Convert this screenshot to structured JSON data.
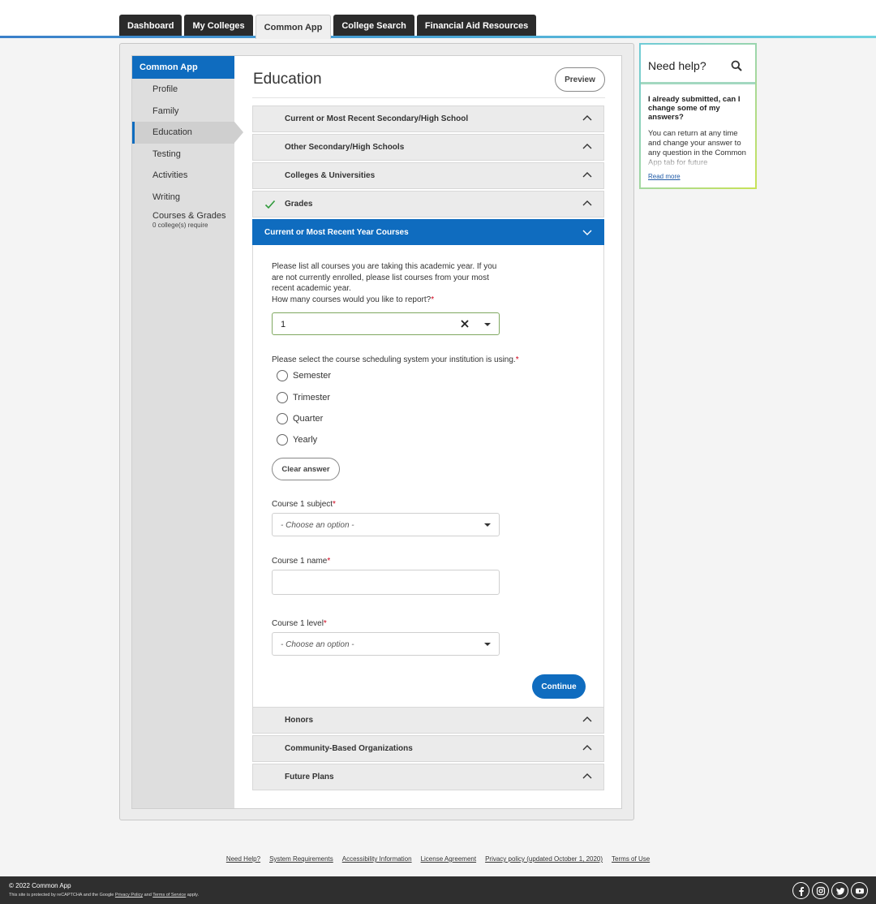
{
  "nav": {
    "tabs": [
      {
        "label": "Dashboard",
        "active": false
      },
      {
        "label": "My Colleges",
        "active": false
      },
      {
        "label": "Common App",
        "active": true
      },
      {
        "label": "College Search",
        "active": false
      },
      {
        "label": "Financial Aid Resources",
        "active": false
      }
    ],
    "accent_color": "#0f6cbf"
  },
  "sidebar": {
    "header": "Common App",
    "items": [
      {
        "label": "Profile"
      },
      {
        "label": "Family"
      },
      {
        "label": "Education",
        "active": true
      },
      {
        "label": "Testing"
      },
      {
        "label": "Activities"
      },
      {
        "label": "Writing"
      },
      {
        "label": "Courses & Grades",
        "sublabel": "0 college(s) require"
      }
    ]
  },
  "main": {
    "title": "Education",
    "preview_label": "Preview",
    "sections": [
      {
        "label": "Current or Most Recent Secondary/High School",
        "state": "collapsed"
      },
      {
        "label": "Other Secondary/High Schools",
        "state": "collapsed"
      },
      {
        "label": "Colleges & Universities",
        "state": "collapsed"
      },
      {
        "label": "Grades",
        "state": "collapsed",
        "completed": true
      },
      {
        "label": "Current or Most Recent Year Courses",
        "state": "expanded"
      },
      {
        "label": "Honors",
        "state": "collapsed"
      },
      {
        "label": "Community-Based Organizations",
        "state": "collapsed"
      },
      {
        "label": "Future Plans",
        "state": "collapsed"
      }
    ],
    "form": {
      "intro": "Please list all courses you are taking this academic year. If you are not currently enrolled, please list courses from your most recent academic year.",
      "count_label": "How many courses would you like to report?",
      "count_value": "1",
      "schedule_label": "Please select the course scheduling system your institution is using.",
      "schedule_options": [
        "Semester",
        "Trimester",
        "Quarter",
        "Yearly"
      ],
      "schedule_selected": null,
      "clear_label": "Clear answer",
      "subject_label": "Course 1 subject",
      "subject_placeholder": "- Choose an option -",
      "name_label": "Course 1 name",
      "name_value": "",
      "level_label": "Course 1 level",
      "level_placeholder": "- Choose an option -",
      "required_mark": "*",
      "continue_label": "Continue"
    }
  },
  "help": {
    "title": "Need help?",
    "question": "I already submitted, can I change some of my answers?",
    "answer": "You can return at any time and change your answer to any question in the Common App tab for future",
    "read_more": "Read more"
  },
  "footer": {
    "links": [
      "Need Help?",
      "System Requirements",
      "Accessibility Information",
      "License Agreement",
      "Privacy policy (updated October 1, 2020)",
      "Terms of Use"
    ],
    "copyright": "© 2022 Common App",
    "captcha_prefix": "This site is protected by reCAPTCHA and the Google ",
    "captcha_privacy": "Privacy Policy",
    "captcha_and": " and ",
    "captcha_terms": "Terms of Service",
    "captcha_suffix": " apply.",
    "social": [
      "facebook",
      "instagram",
      "twitter",
      "youtube"
    ]
  }
}
